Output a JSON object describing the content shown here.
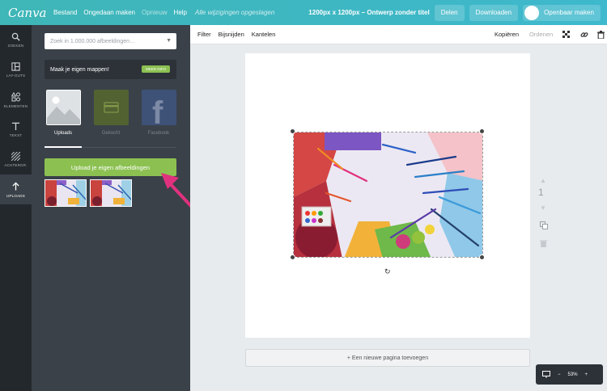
{
  "app": {
    "logo": "Canva"
  },
  "topbar": {
    "menu": [
      "Bestand",
      "Ongedaan maken",
      "Opnieuw",
      "Help"
    ],
    "saved_status": "Alle wijzigingen opgeslagen",
    "doc_title": "1200px x 1200px – Ontwerp zonder titel",
    "share_label": "Delen",
    "download_label": "Downloaden",
    "public_label": "Openbaar maken"
  },
  "iconbar": {
    "items": [
      {
        "label": "ZOEKEN",
        "icon": "search-icon"
      },
      {
        "label": "LAY-OUTS",
        "icon": "layouts-icon"
      },
      {
        "label": "ELEMENTEN",
        "icon": "elements-icon"
      },
      {
        "label": "TEKST",
        "icon": "text-icon"
      },
      {
        "label": "ACHTERGR.",
        "icon": "background-icon"
      },
      {
        "label": "UPLOADS",
        "icon": "upload-arrow-icon"
      }
    ]
  },
  "panel": {
    "search_placeholder": "Zoek in 1.000.000 afbeeldingen…",
    "folders_text": "Maak je eigen mappen!",
    "folders_button": "MEER INFO",
    "tabs": [
      "Uploads",
      "Gekocht",
      "Facebook"
    ],
    "upload_button": "Upload je eigen afbeeldingen"
  },
  "toolbar": {
    "left": [
      "Filter",
      "Bijsnijden",
      "Kantelen"
    ],
    "copy": "Kopiëren",
    "arrange": "Ordenen"
  },
  "canvas": {
    "page_number": "1",
    "new_page": "+ Een nieuwe pagina toevoegen",
    "zoom": "53%"
  },
  "colors": {
    "topbar": "#3fb6b7",
    "accent_green": "#8cc152",
    "arrow": "#e0317e"
  }
}
